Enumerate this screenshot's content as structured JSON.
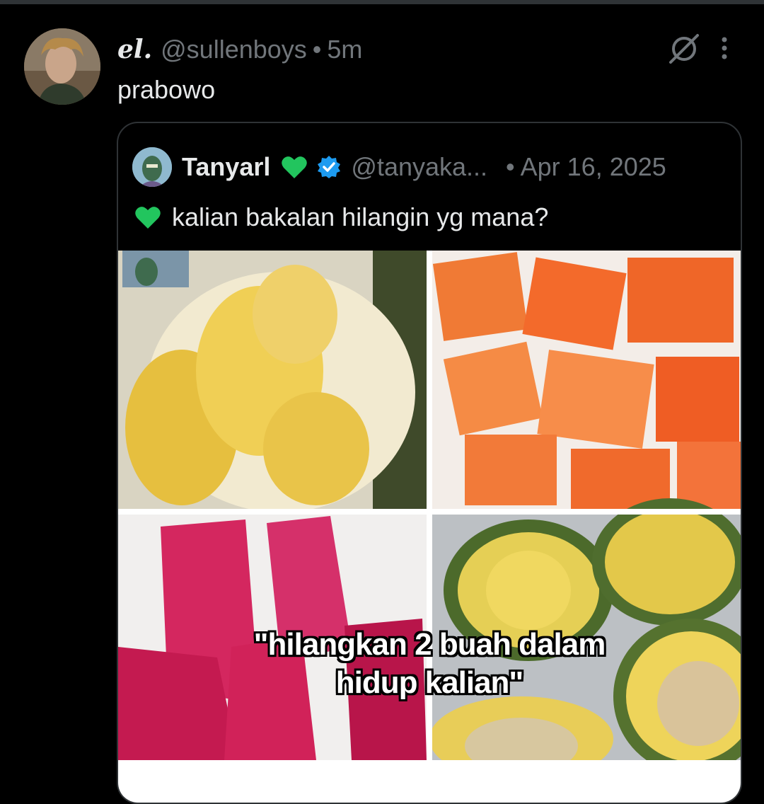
{
  "post": {
    "display_name": "el.",
    "handle": "@sullenboys",
    "separator": "•",
    "time": "5m",
    "text": "prabowo"
  },
  "quoted_post": {
    "display_name": "Tanyarl",
    "handle": "@tanyaka...",
    "separator": "•",
    "date": "Apr 16, 2025",
    "text": "kalian bakalan hilangin yg mana?",
    "media_caption_line1": "\"hilangkan 2 buah dalam",
    "media_caption_line2": "hidup kalian\""
  },
  "icons": {
    "grok": "grok-icon",
    "more": "more-icon",
    "verified": "verified-badge-icon",
    "heart": "green-heart-emoji"
  },
  "colors": {
    "background": "#000000",
    "text_primary": "#e7e9ea",
    "text_secondary": "#71767b",
    "verified_blue": "#1d9bf0",
    "green_heart": "#22c55e"
  }
}
